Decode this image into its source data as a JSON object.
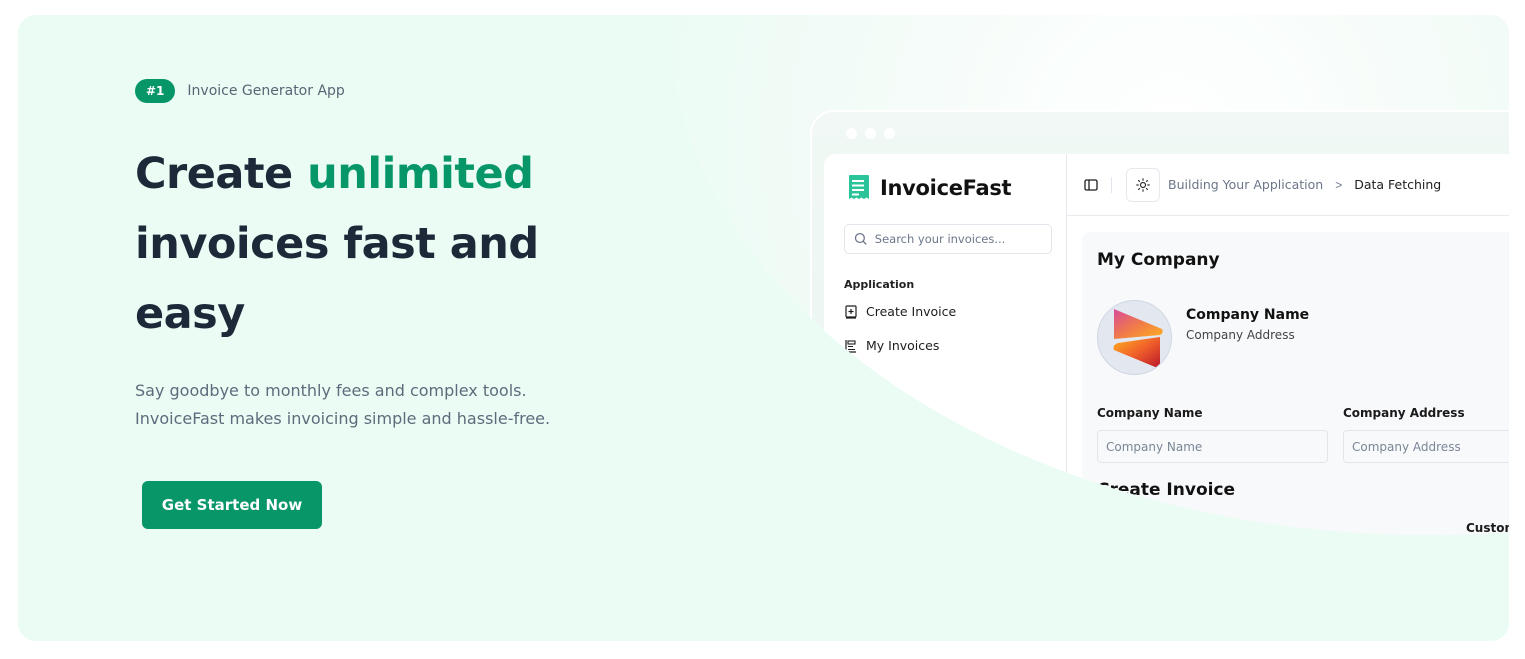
{
  "hero": {
    "badge": "#1",
    "badge_text": "Invoice Generator App",
    "headline_part1": "Create ",
    "headline_accent": "unlimited",
    "headline_part2": " invoices fast and easy",
    "subtext_line1": "Say goodbye to monthly fees and complex tools.",
    "subtext_line2": "InvoiceFast makes invoicing simple and hassle-free.",
    "cta_label": "Get Started Now"
  },
  "colors": {
    "accent": "#069668",
    "background": "#eafcf4",
    "heading": "#1d2839",
    "brand_icon": "#2bc49a"
  },
  "mockup": {
    "app_name": "InvoiceFast",
    "search_placeholder": "Search your invoices...",
    "sidebar_group": "Application",
    "nav_items": [
      {
        "label": "Create Invoice",
        "icon": "plus-book-icon"
      },
      {
        "label": "My Invoices",
        "icon": "list-icon"
      }
    ],
    "breadcrumb": {
      "parent": "Building Your Application",
      "separator": ">",
      "current": "Data Fetching"
    },
    "company_section_title": "My Company",
    "company_name": "Company Name",
    "company_address": "Company Address",
    "fields": {
      "company_name_label": "Company Name",
      "company_name_placeholder": "Company Name",
      "company_address_label": "Company Address",
      "company_address_placeholder": "Company Address",
      "customer_name_label": "Customer Name",
      "customer_second_label": "Custom"
    },
    "invoice_section_title": "Create Invoice"
  }
}
